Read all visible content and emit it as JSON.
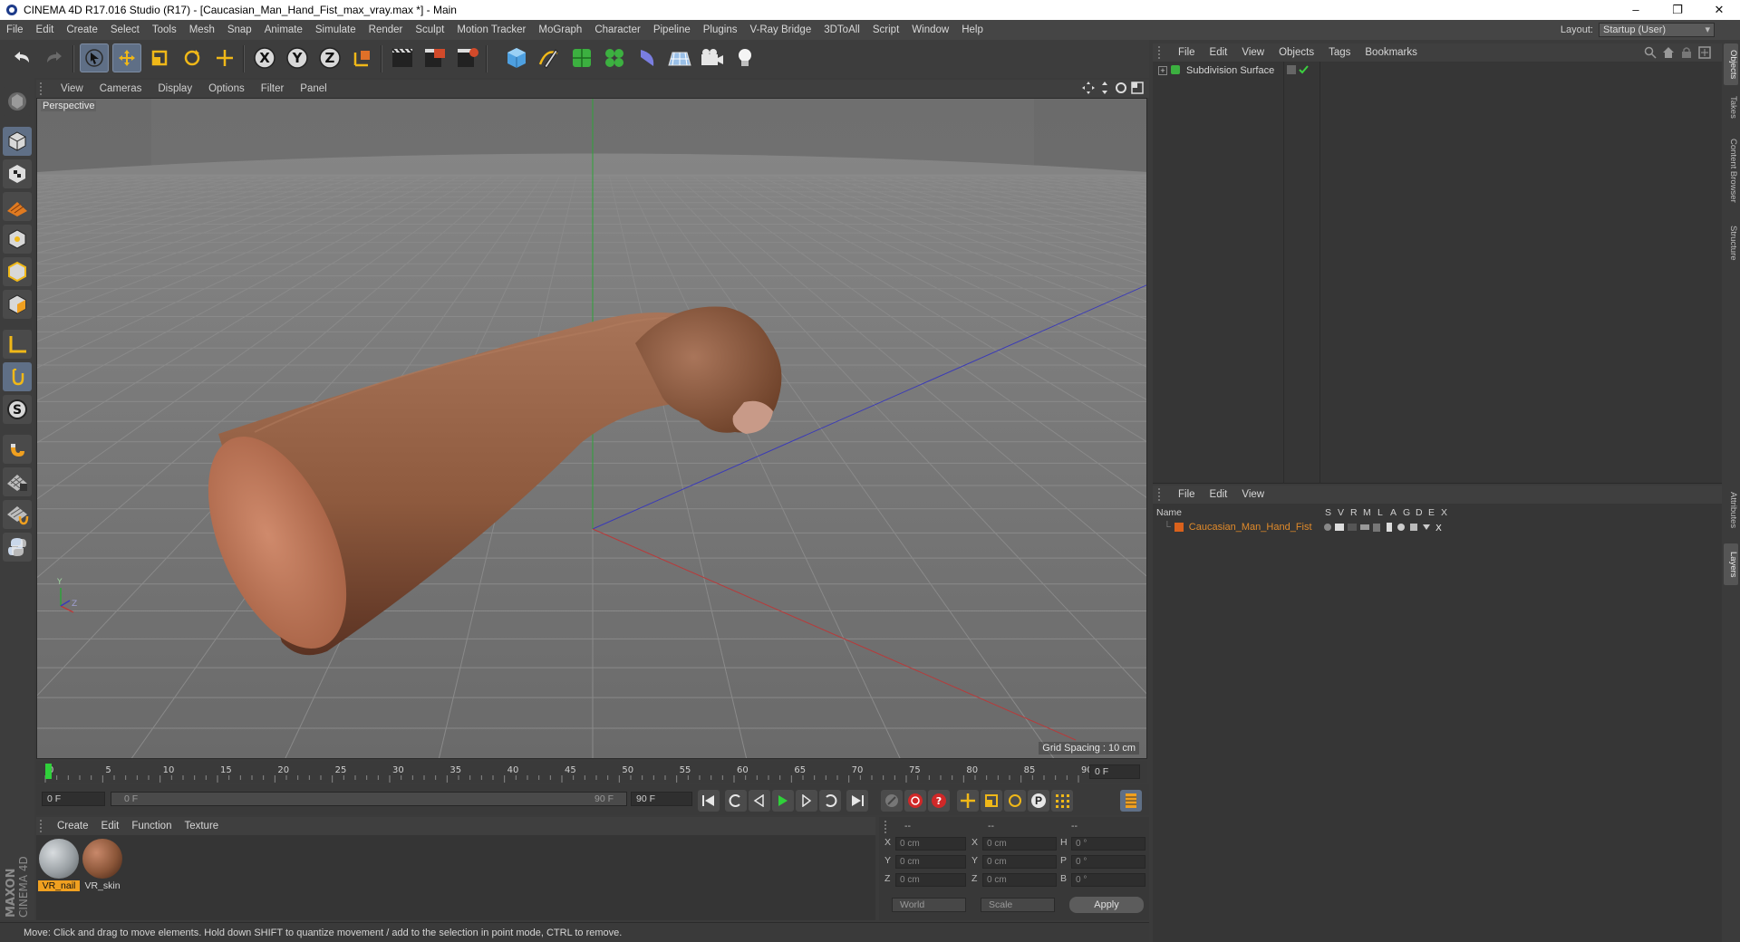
{
  "window": {
    "title": "CINEMA 4D R17.016 Studio (R17) - [Caucasian_Man_Hand_Fist_max_vray.max *] - Main",
    "controls": [
      "–",
      "❐",
      "✕"
    ]
  },
  "menubar": {
    "items": [
      "File",
      "Edit",
      "Create",
      "Select",
      "Tools",
      "Mesh",
      "Snap",
      "Animate",
      "Simulate",
      "Render",
      "Sculpt",
      "Motion Tracker",
      "MoGraph",
      "Character",
      "Pipeline",
      "Plugins",
      "V-Ray Bridge",
      "3DToAll",
      "Script",
      "Window",
      "Help"
    ],
    "layout_label": "Layout:",
    "layout_value": "Startup (User)"
  },
  "toolbar": {
    "icons": [
      "undo-icon",
      "redo-icon",
      "select-arrow-icon",
      "move-icon",
      "scale-icon",
      "rotate-icon",
      "move-axis-icon",
      "x-axis-icon",
      "y-axis-icon",
      "z-axis-icon",
      "coordinate-system-icon",
      "render-view-icon",
      "render-picture-viewer-icon",
      "edit-render-settings-icon",
      "cube-icon",
      "pen-spline-icon",
      "subdivision-icon",
      "cloner-icon",
      "deformer-icon",
      "floor-icon",
      "camera-icon",
      "light-icon"
    ],
    "axis_labels": [
      "X",
      "Y",
      "Z"
    ]
  },
  "left_tools": [
    "model-mode-icon",
    "object-mode-icon",
    "texture-mode-icon",
    "workplane-icon",
    "points-mode-icon",
    "edges-mode-icon",
    "polygons-mode-icon",
    "axis-mode-icon",
    "tweak-icon",
    "snap-s-icon",
    "magnet-icon",
    "grid-lock-icon",
    "enable-snap-icon",
    "python-icon"
  ],
  "viewport": {
    "menu": [
      "View",
      "Cameras",
      "Display",
      "Options",
      "Filter",
      "Panel"
    ],
    "label": "Perspective",
    "grid_spacing": "Grid Spacing : 10 cm",
    "axis_gizmo": {
      "y": "Y",
      "z": "Z"
    }
  },
  "timeline": {
    "ticks": [
      "0",
      "5",
      "10",
      "15",
      "20",
      "25",
      "30",
      "35",
      "40",
      "45",
      "50",
      "55",
      "60",
      "65",
      "70",
      "75",
      "80",
      "85",
      "90"
    ],
    "current_frame": "0 F",
    "start_field": "0 F",
    "range_start": "0 F",
    "range_end": "90 F",
    "end_field": "90 F",
    "playback_icons": [
      "go-to-start-icon",
      "previous-key-icon",
      "play-backwards-icon",
      "play-icon",
      "next-frame-icon",
      "next-key-icon",
      "go-to-end-icon"
    ],
    "record_icons": [
      "motion-record-icon",
      "record-icon",
      "autokey-icon",
      "key-move-icon",
      "key-scale-icon",
      "key-rotate-icon",
      "key-param-icon",
      "key-pla-icon",
      "timeline-icon"
    ],
    "param_letter": "P"
  },
  "materials": {
    "menu": [
      "Create",
      "Edit",
      "Function",
      "Texture"
    ],
    "items": [
      {
        "name": "VR_nail",
        "selected": true,
        "color": "#9aa0a4"
      },
      {
        "name": "VR_skin",
        "selected": false,
        "color": "#8a5538"
      }
    ]
  },
  "coordinates": {
    "header": [
      "--",
      "--",
      "--"
    ],
    "rows": [
      {
        "l1": "X",
        "v1": "0 cm",
        "l2": "X",
        "v2": "0 cm",
        "l3": "H",
        "v3": "0 °"
      },
      {
        "l1": "Y",
        "v1": "0 cm",
        "l2": "Y",
        "v2": "0 cm",
        "l3": "P",
        "v3": "0 °"
      },
      {
        "l1": "Z",
        "v1": "0 cm",
        "l2": "Z",
        "v2": "0 cm",
        "l3": "B",
        "v3": "0 °"
      }
    ],
    "mode": "World",
    "transform": "Scale",
    "apply": "Apply"
  },
  "objects_panel": {
    "menu": [
      "File",
      "Edit",
      "View",
      "Objects",
      "Tags",
      "Bookmarks"
    ],
    "items": [
      {
        "name": "Subdivision Surface"
      }
    ]
  },
  "layers_panel": {
    "menu": [
      "File",
      "Edit",
      "View"
    ],
    "columns": [
      "Name",
      "S",
      "V",
      "R",
      "M",
      "L",
      "A",
      "G",
      "D",
      "E",
      "X"
    ],
    "items": [
      {
        "name": "Caucasian_Man_Hand_Fist",
        "color": "#d9611c"
      }
    ]
  },
  "side_tabs": [
    "Objects",
    "Takes",
    "Content Browser",
    "Structure",
    "Attributes",
    "Layers"
  ],
  "branding": {
    "logo_text": "MAXON CINEMA 4D"
  },
  "status": "Move: Click and drag to move elements. Hold down SHIFT to quantize movement / add to the selection in point mode, CTRL to remove.",
  "colors": {
    "accent_select": "#5f6f86",
    "layer_text": "#e08a2a",
    "grid_line": "#838383",
    "axis_x": "#b83a3a",
    "axis_y": "#2fa33a",
    "axis_z": "#3a3ab8"
  }
}
